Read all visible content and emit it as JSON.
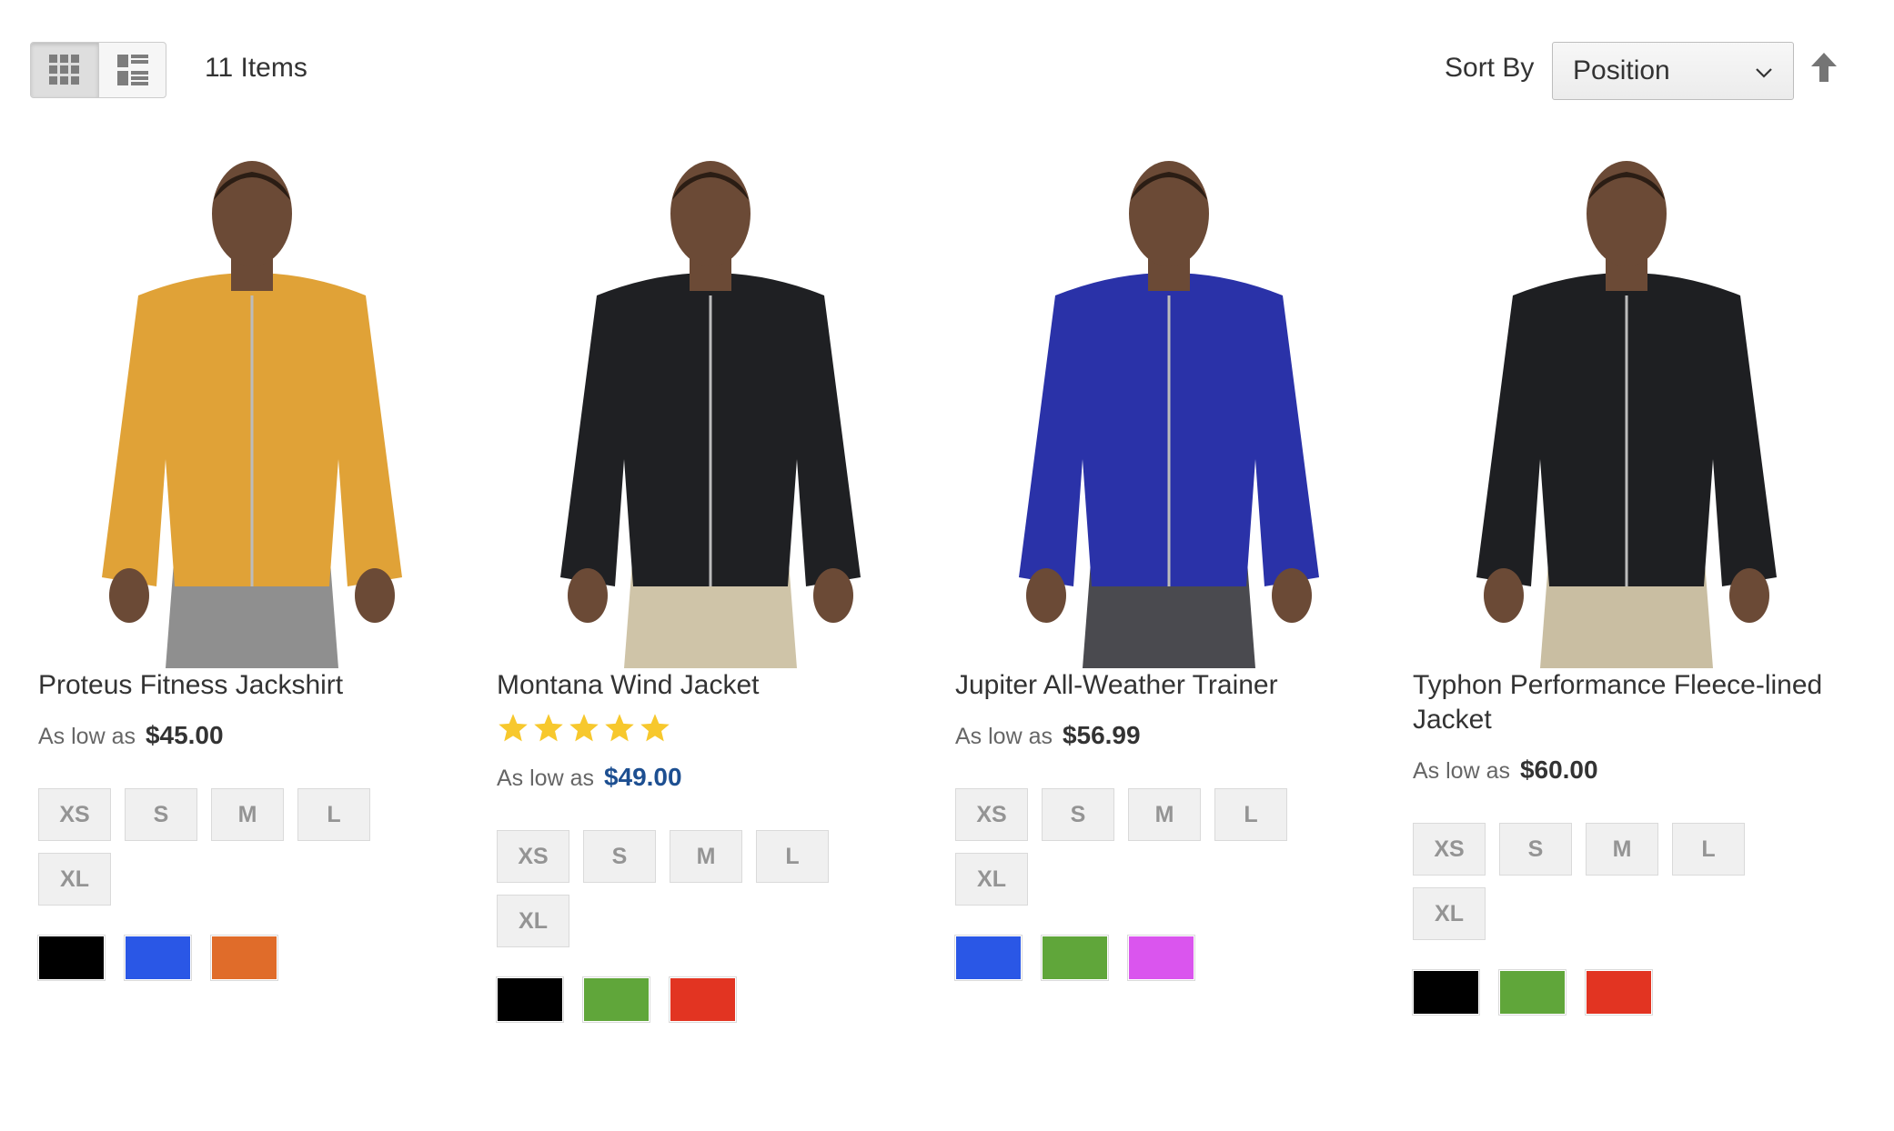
{
  "toolbar": {
    "item_count": "11 Items",
    "sort_label": "Sort By",
    "sort_value": "Position",
    "view_modes": [
      "grid-icon",
      "list-icon"
    ],
    "active_mode": "grid"
  },
  "products": [
    {
      "name": "Proteus Fitness Jackshirt",
      "price_prefix": "As low as",
      "price": "$45.00",
      "rating_stars": 0,
      "sizes": [
        "XS",
        "S",
        "M",
        "L",
        "XL"
      ],
      "colors": [
        "#000000",
        "#2a57e6",
        "#e06c2a"
      ],
      "jacket_color": "#e0a237",
      "pants_color": "#8f8f8f"
    },
    {
      "name": "Montana Wind Jacket",
      "price_prefix": "As low as",
      "price": "$49.00",
      "rating_stars": 5,
      "sizes": [
        "XS",
        "S",
        "M",
        "L",
        "XL"
      ],
      "colors": [
        "#000000",
        "#60a63a",
        "#e23422"
      ],
      "jacket_color": "#1f2023",
      "pants_color": "#cfc4a8"
    },
    {
      "name": "Jupiter All-Weather Trainer",
      "price_prefix": "As low as",
      "price": "$56.99",
      "rating_stars": 0,
      "sizes": [
        "XS",
        "S",
        "M",
        "L",
        "XL"
      ],
      "colors": [
        "#2a57e6",
        "#60a63a",
        "#da55ee"
      ],
      "jacket_color": "#2a32a8",
      "pants_color": "#4a4a4f"
    },
    {
      "name": "Typhon Performance Fleece-lined Jacket",
      "price_prefix": "As low as",
      "price": "$60.00",
      "rating_stars": 0,
      "sizes": [
        "XS",
        "S",
        "M",
        "L",
        "XL"
      ],
      "colors": [
        "#000000",
        "#60a63a",
        "#e23422"
      ],
      "jacket_color": "#1e1f22",
      "pants_color": "#c9bea2"
    }
  ],
  "colors": {
    "text": "#333333",
    "muted": "#666666",
    "price_link": "#1d4f91",
    "star": "#f7c82d",
    "skin": "#6b4a36"
  }
}
